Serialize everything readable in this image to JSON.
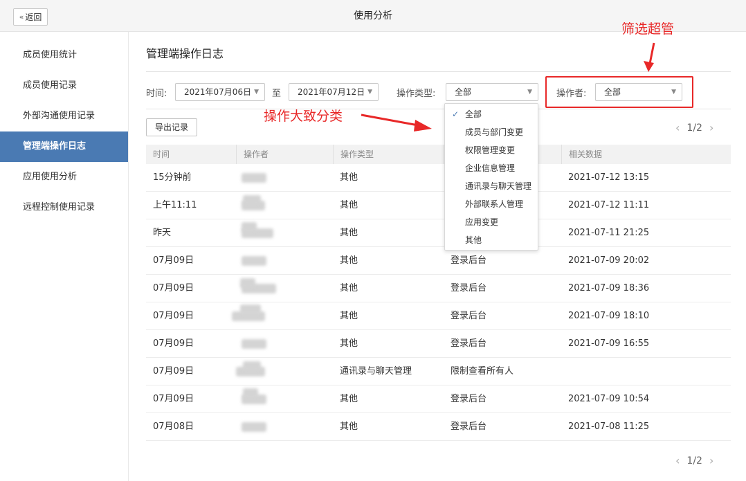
{
  "topbar": {
    "back_label": "返回",
    "back_icon": "double-chevron-left-icon",
    "title": "使用分析"
  },
  "sidebar": {
    "items": [
      {
        "label": "成员使用统计",
        "active": false
      },
      {
        "label": "成员使用记录",
        "active": false
      },
      {
        "label": "外部沟通使用记录",
        "active": false
      },
      {
        "label": "管理端操作日志",
        "active": true
      },
      {
        "label": "应用使用分析",
        "active": false
      },
      {
        "label": "远程控制使用记录",
        "active": false
      }
    ]
  },
  "main": {
    "title": "管理端操作日志",
    "filters": {
      "time_label": "时间:",
      "start_date": "2021年07月06日",
      "to_label": "至",
      "end_date": "2021年07月12日",
      "op_type_label": "操作类型:",
      "op_type_value": "全部",
      "operator_label": "操作者:",
      "operator_value": "全部"
    },
    "export_label": "导出记录",
    "pager_top": "1/2",
    "pager_bottom": "1/2",
    "columns": [
      "时间",
      "操作者",
      "操作类型",
      "",
      "相关数据"
    ],
    "rows": [
      {
        "time": "15分钟前",
        "op_type": "其他",
        "action": "",
        "data": "2021-07-12 13:15"
      },
      {
        "time": "上午11:11",
        "op_type": "其他",
        "action": "",
        "data": "2021-07-12 11:11"
      },
      {
        "time": "昨天",
        "op_type": "其他",
        "action": "",
        "data": "2021-07-11 21:25"
      },
      {
        "time": "07月09日",
        "op_type": "其他",
        "action": "登录后台",
        "data": "2021-07-09 20:02"
      },
      {
        "time": "07月09日",
        "op_type": "其他",
        "action": "登录后台",
        "data": "2021-07-09 18:36"
      },
      {
        "time": "07月09日",
        "op_type": "其他",
        "action": "登录后台",
        "data": "2021-07-09 18:10"
      },
      {
        "time": "07月09日",
        "op_type": "其他",
        "action": "登录后台",
        "data": "2021-07-09 16:55"
      },
      {
        "time": "07月09日",
        "op_type": "通讯录与聊天管理",
        "action": "限制查看所有人",
        "data": ""
      },
      {
        "time": "07月09日",
        "op_type": "其他",
        "action": "登录后台",
        "data": "2021-07-09 10:54"
      },
      {
        "time": "07月08日",
        "op_type": "其他",
        "action": "登录后台",
        "data": "2021-07-08 11:25"
      }
    ]
  },
  "dropdown": {
    "options": [
      "全部",
      "成员与部门变更",
      "权限管理变更",
      "企业信息管理",
      "通讯录与聊天管理",
      "外部联系人管理",
      "应用变更",
      "其他"
    ],
    "selected_index": 0
  },
  "annotations": {
    "operator_filter": "筛选超管",
    "op_type": "操作大致分类",
    "color": "#e82828"
  },
  "colors": {
    "accent": "#4a7ab3",
    "annotation": "#e82828"
  }
}
